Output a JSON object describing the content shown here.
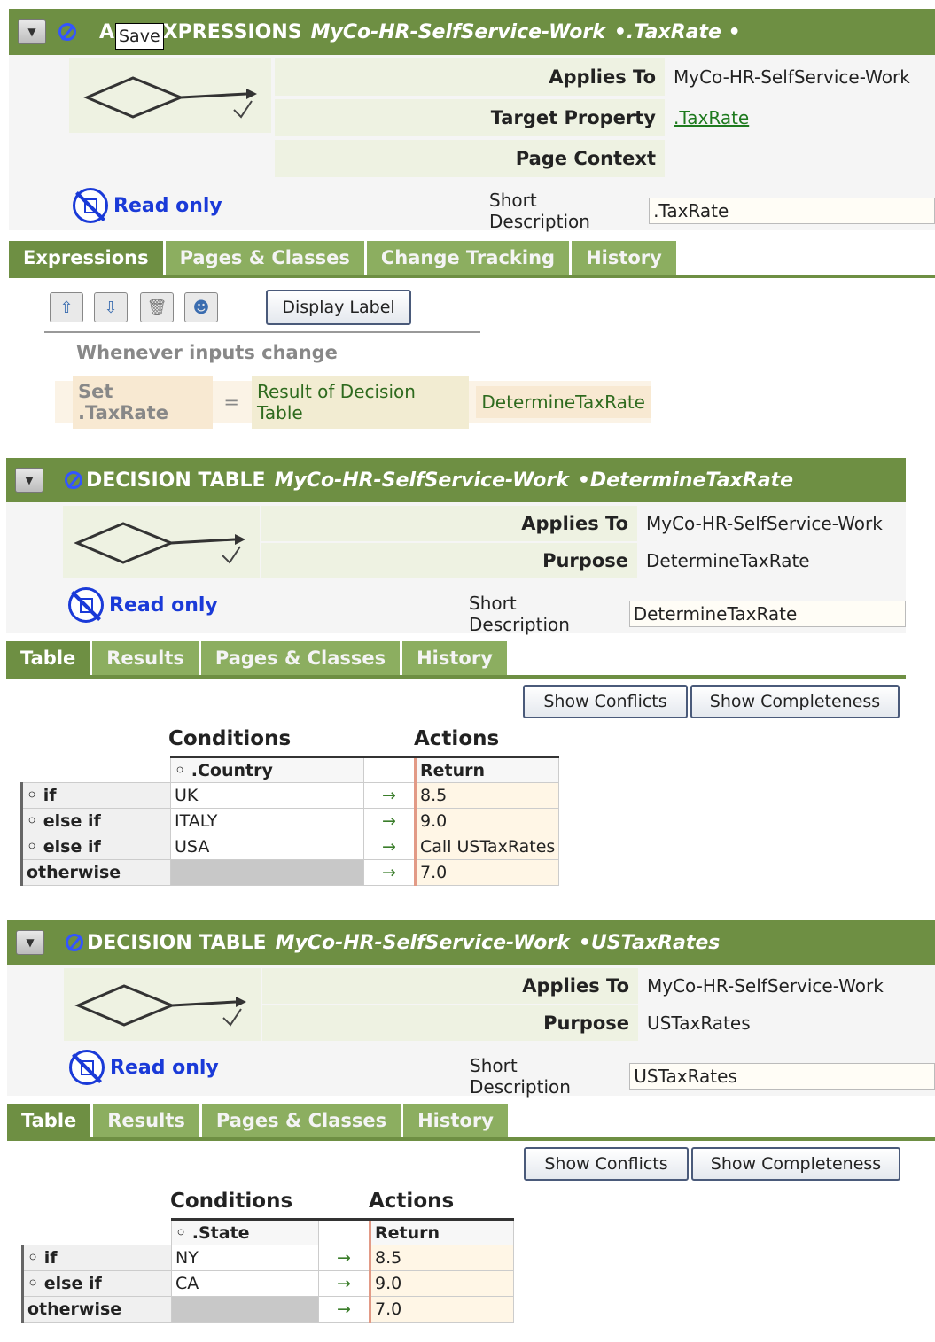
{
  "tooltip": "Save",
  "panel1": {
    "rule_type": "ARE EXPRESSIONS",
    "rule_class": "MyCo-HR-SelfService-Work",
    "rule_name": "•.TaxRate •",
    "labels": {
      "applies_to": "Applies To",
      "target_property": "Target Property",
      "page_context": "Page Context",
      "short_description": "Short Description"
    },
    "values": {
      "applies_to": "MyCo-HR-SelfService-Work",
      "target_property": ".TaxRate",
      "page_context": "",
      "short_description": ".TaxRate"
    },
    "read_only": "Read only",
    "tabs": [
      "Expressions",
      "Pages & Classes",
      "Change Tracking",
      "History"
    ],
    "display_label_button": "Display Label",
    "whenever": "Whenever inputs change",
    "expr": {
      "set": "Set .TaxRate",
      "eq": "=",
      "result": "Result of Decision Table",
      "table": "DetermineTaxRate"
    }
  },
  "panel2": {
    "rule_type": "DECISION TABLE",
    "rule_class": "MyCo-HR-SelfService-Work",
    "rule_name": "•DetermineTaxRate",
    "labels": {
      "applies_to": "Applies To",
      "purpose": "Purpose",
      "short_description": "Short Description"
    },
    "values": {
      "applies_to": "MyCo-HR-SelfService-Work",
      "purpose": "DetermineTaxRate",
      "short_description": "DetermineTaxRate"
    },
    "read_only": "Read only",
    "tabs": [
      "Table",
      "Results",
      "Pages & Classes",
      "History"
    ],
    "show_conflicts": "Show Conflicts",
    "show_completeness": "Show Completeness",
    "conditions": "Conditions",
    "actions": "Actions",
    "cond_column": "◦ .Country",
    "return_column": "Return",
    "rows": [
      {
        "kw": "◦ if",
        "cond": "UK",
        "arrow": "→",
        "ret": "8.5"
      },
      {
        "kw": "◦ else if",
        "cond": "ITALY",
        "arrow": "→",
        "ret": "9.0"
      },
      {
        "kw": "◦ else if",
        "cond": "USA",
        "arrow": "→",
        "ret": "Call USTaxRates"
      },
      {
        "kw": "otherwise",
        "cond": "",
        "arrow": "→",
        "ret": "7.0"
      }
    ]
  },
  "panel3": {
    "rule_type": "DECISION TABLE",
    "rule_class": "MyCo-HR-SelfService-Work",
    "rule_name": "•USTaxRates",
    "labels": {
      "applies_to": "Applies To",
      "purpose": "Purpose",
      "short_description": "Short Description"
    },
    "values": {
      "applies_to": "MyCo-HR-SelfService-Work",
      "purpose": "USTaxRates",
      "short_description": "USTaxRates"
    },
    "read_only": "Read only",
    "tabs": [
      "Table",
      "Results",
      "Pages & Classes",
      "History"
    ],
    "show_conflicts": "Show Conflicts",
    "show_completeness": "Show Completeness",
    "conditions": "Conditions",
    "actions": "Actions",
    "cond_column": "◦ .State",
    "return_column": "Return",
    "rows": [
      {
        "kw": "◦ if",
        "cond": "NY",
        "arrow": "→",
        "ret": "8.5"
      },
      {
        "kw": "◦ else if",
        "cond": "CA",
        "arrow": "→",
        "ret": "9.0"
      },
      {
        "kw": "otherwise",
        "cond": "",
        "arrow": "→",
        "ret": "7.0"
      }
    ]
  }
}
